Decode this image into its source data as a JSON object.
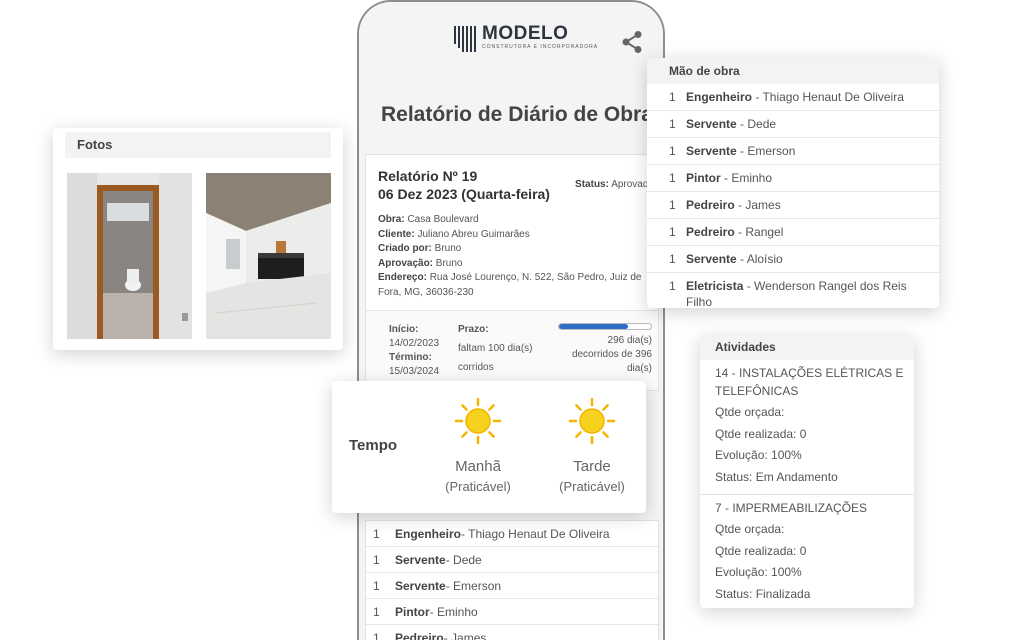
{
  "brand": {
    "name": "MODELO",
    "tagline": "CONSTRUTORA E INCORPORADORA"
  },
  "report": {
    "title": "Relatório de Diário de Obra",
    "number": "Relatório Nº 19",
    "date": "06 Dez 2023 (Quarta-feira)",
    "status_label": "Status:",
    "status_value": "Aprovado",
    "obra_label": "Obra:",
    "obra": "Casa Boulevard",
    "cliente_label": "Cliente:",
    "cliente": "Juliano Abreu Guimarães",
    "criado_label": "Criado por:",
    "criado": "Bruno",
    "aprovacao_label": "Aprovação:",
    "aprovacao": "Bruno",
    "endereco_label": "Endereço:",
    "endereco": "Rua José Lourenço, N. 522, São Pedro, Juiz de Fora, MG, 36036-230"
  },
  "progress": {
    "inicio_label": "Início:",
    "inicio": "14/02/2023",
    "termino_label": "Término:",
    "termino": "15/03/2024",
    "prazo_label": "Prazo:",
    "prazo": "faltam 100 dia(s) corridos",
    "line1": "296 dia(s)",
    "line2": "decorridos de 396",
    "line3": "dia(s)",
    "fraction": 0.75
  },
  "tempo": {
    "label": "Tempo",
    "periods": [
      {
        "name": "Manhã",
        "condition": "(Praticável)",
        "icon": "sun-icon"
      },
      {
        "name": "Tarde",
        "condition": "(Praticável)",
        "icon": "sun-icon"
      }
    ]
  },
  "fotos": {
    "title": "Fotos"
  },
  "mao_de_obra": {
    "title": "Mão de obra",
    "rows": [
      {
        "qty": "1",
        "role": "Engenheiro",
        "name": " - Thiago Henaut De Oliveira"
      },
      {
        "qty": "1",
        "role": "Servente",
        "name": " - Dede"
      },
      {
        "qty": "1",
        "role": "Servente",
        "name": " - Emerson"
      },
      {
        "qty": "1",
        "role": "Pintor",
        "name": " - Eminho"
      },
      {
        "qty": "1",
        "role": "Pedreiro",
        "name": " - James"
      },
      {
        "qty": "1",
        "role": "Pedreiro",
        "name": " - Rangel"
      },
      {
        "qty": "1",
        "role": "Servente",
        "name": " - Aloísio"
      },
      {
        "qty": "1",
        "role": "Eletricista",
        "name": " - Wenderson Rangel dos Reis Filho"
      }
    ]
  },
  "atividades": {
    "title": "Atividades",
    "items": [
      {
        "title": "14 - INSTALAÇÕES ELÉTRICAS E TELEFÔNICAS",
        "orcada": "Qtde orçada:",
        "realizada": "Qtde realizada: 0",
        "evolucao": "Evolução: 100%",
        "status": "Status: Em Andamento"
      },
      {
        "title": "7 - IMPERMEABILIZAÇÕES",
        "orcada": "Qtde orçada:",
        "realizada": "Qtde realizada: 0",
        "evolucao": "Evolução: 100%",
        "status": "Status: Finalizada"
      }
    ]
  },
  "phone_list": [
    {
      "qty": "1",
      "role": "Engenheiro",
      "name": " - Thiago Henaut De Oliveira"
    },
    {
      "qty": "1",
      "role": "Servente",
      "name": " - Dede"
    },
    {
      "qty": "1",
      "role": "Servente",
      "name": " - Emerson"
    },
    {
      "qty": "1",
      "role": "Pintor",
      "name": " - Eminho"
    },
    {
      "qty": "1",
      "role": "Pedreiro",
      "name": " - James"
    }
  ]
}
